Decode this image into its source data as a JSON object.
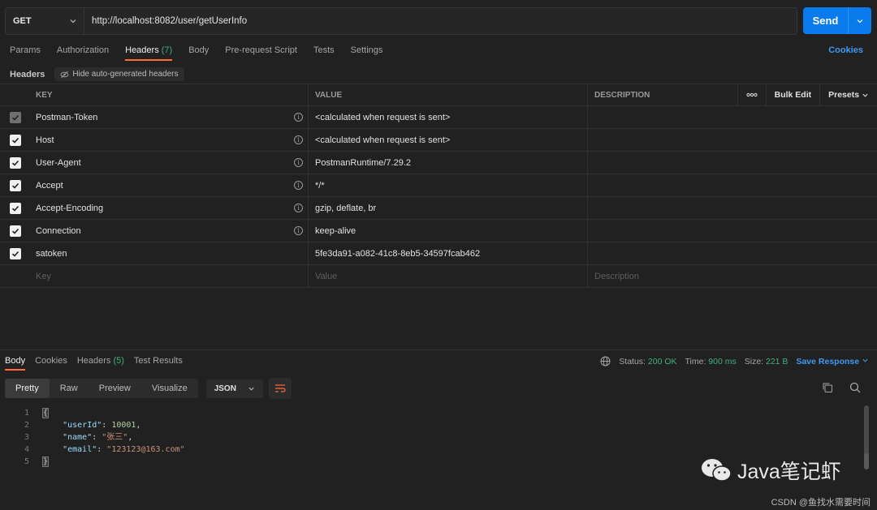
{
  "request": {
    "method": "GET",
    "url": "http://localhost:8082/user/getUserInfo",
    "send_label": "Send"
  },
  "req_tabs": [
    {
      "label": "Params",
      "count": ""
    },
    {
      "label": "Authorization",
      "count": ""
    },
    {
      "label": "Headers",
      "count": "(7)"
    },
    {
      "label": "Body",
      "count": ""
    },
    {
      "label": "Pre-request Script",
      "count": ""
    },
    {
      "label": "Tests",
      "count": ""
    },
    {
      "label": "Settings",
      "count": ""
    }
  ],
  "cookies_label": "Cookies",
  "headers_section": {
    "title": "Headers",
    "hide_auto_label": "Hide auto-generated headers"
  },
  "table": {
    "col_key": "KEY",
    "col_value": "VALUE",
    "col_description": "DESCRIPTION",
    "more_label": "ooo",
    "bulk_edit": "Bulk Edit",
    "presets": "Presets",
    "rows": [
      {
        "key": "Postman-Token",
        "value": "<calculated when request is sent>",
        "info": true
      },
      {
        "key": "Host",
        "value": "<calculated when request is sent>",
        "info": true
      },
      {
        "key": "User-Agent",
        "value": "PostmanRuntime/7.29.2",
        "info": true
      },
      {
        "key": "Accept",
        "value": "*/*",
        "info": true
      },
      {
        "key": "Accept-Encoding",
        "value": "gzip, deflate, br",
        "info": true
      },
      {
        "key": "Connection",
        "value": "keep-alive",
        "info": true
      },
      {
        "key": "satoken",
        "value": "5fe3da91-a082-41c8-8eb5-34597fcab462",
        "info": false
      }
    ],
    "placeholder": {
      "key": "Key",
      "value": "Value",
      "description": "Description"
    }
  },
  "response": {
    "tabs": [
      {
        "label": "Body",
        "count": ""
      },
      {
        "label": "Cookies",
        "count": ""
      },
      {
        "label": "Headers",
        "count": "(5)"
      },
      {
        "label": "Test Results",
        "count": ""
      }
    ],
    "status_label": "Status:",
    "status_value": "200 OK",
    "time_label": "Time:",
    "time_value": "900 ms",
    "size_label": "Size:",
    "size_value": "221 B",
    "save_label": "Save Response",
    "view_modes": [
      "Pretty",
      "Raw",
      "Preview",
      "Visualize"
    ],
    "format": "JSON",
    "line_numbers": [
      "1",
      "2",
      "3",
      "4",
      "5"
    ],
    "body": {
      "open": "{",
      "close": "}",
      "fields": [
        {
          "key": "\"userId\"",
          "value": "10001",
          "type": "number",
          "comma": ","
        },
        {
          "key": "\"name\"",
          "value": "\"张三\"",
          "type": "string",
          "comma": ","
        },
        {
          "key": "\"email\"",
          "value": "\"123123@163.com\"",
          "type": "string",
          "comma": ""
        }
      ]
    }
  },
  "watermark": {
    "brand": "Java笔记虾",
    "csdn": "CSDN @鱼找水需要时间"
  }
}
